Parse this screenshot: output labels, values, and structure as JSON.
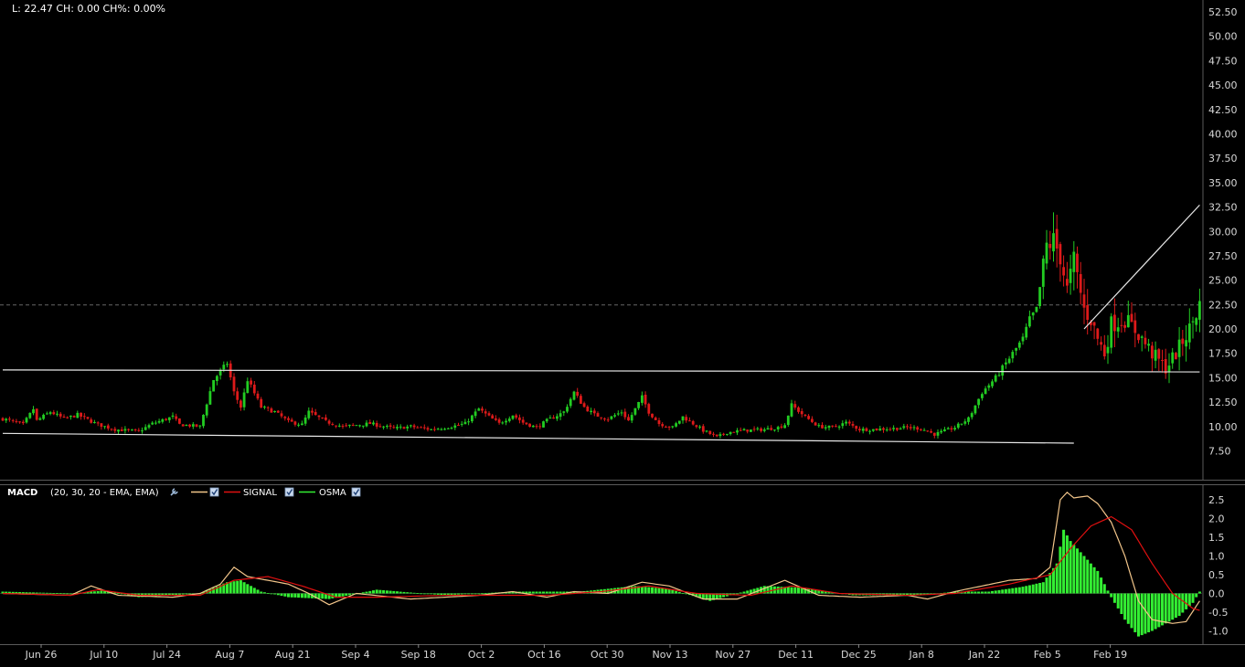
{
  "info_bar": {
    "text": "L: 22.47 CH: 0.00 CH%: 0.00%"
  },
  "colors": {
    "background": "#000000",
    "up": "#22cc22",
    "down": "#dd1a1a",
    "macd_line": "#f2c58a",
    "signal_line": "#e01010",
    "osma": "#33ee33",
    "trendline": "#e8e8e8"
  },
  "macd_legend": {
    "name": "MACD",
    "params": "(20, 30, 20 - EMA, EMA)",
    "signal": "SIGNAL",
    "osma": "OSMA",
    "settings_icon": "wrench-icon",
    "check_icon": "checkbox-checked-icon"
  },
  "chart_data": [
    {
      "type": "candlestick",
      "name_panel": "price",
      "title": "",
      "xlabel": "",
      "ylabel": "",
      "ylim": [
        5.0,
        53.5
      ],
      "yticks": [
        "52.50",
        "50.00",
        "47.50",
        "45.00",
        "42.50",
        "40.00",
        "37.50",
        "35.00",
        "32.50",
        "30.00",
        "27.50",
        "25.00",
        "22.50",
        "20.00",
        "17.50",
        "15.00",
        "12.50",
        "10.00",
        "7.50"
      ],
      "ytick_values": [
        52.5,
        50,
        47.5,
        45,
        42.5,
        40,
        37.5,
        35,
        32.5,
        30,
        27.5,
        25,
        22.5,
        20,
        17.5,
        15,
        12.5,
        10,
        7.5
      ],
      "xticks": [
        "Jun 26",
        "Jul 10",
        "Jul 24",
        "Aug 7",
        "Aug 21",
        "Sep 4",
        "Sep 18",
        "Oct 2",
        "Oct 16",
        "Oct 30",
        "Nov 13",
        "Nov 27",
        "Dec 11",
        "Dec 25",
        "Jan 8",
        "Jan 22",
        "Feb 5",
        "Feb 19"
      ],
      "last_value": 22.47,
      "price_path": [
        [
          0,
          10.8
        ],
        [
          6,
          10.2
        ],
        [
          9,
          11.8
        ],
        [
          10,
          10.6
        ],
        [
          14,
          11.5
        ],
        [
          18,
          10.8
        ],
        [
          22,
          11.2
        ],
        [
          28,
          10.2
        ],
        [
          33,
          9.7
        ],
        [
          40,
          9.5
        ],
        [
          44,
          10.3
        ],
        [
          50,
          11.0
        ],
        [
          52,
          10.2
        ],
        [
          58,
          10.0
        ],
        [
          62,
          14.8
        ],
        [
          66,
          16.5
        ],
        [
          68,
          13.5
        ],
        [
          70,
          12.0
        ],
        [
          72,
          14.8
        ],
        [
          76,
          12.0
        ],
        [
          80,
          11.5
        ],
        [
          84,
          10.5
        ],
        [
          88,
          10.2
        ],
        [
          90,
          11.5
        ],
        [
          95,
          10.5
        ],
        [
          100,
          10.0
        ],
        [
          108,
          10.3
        ],
        [
          115,
          9.8
        ],
        [
          120,
          10.0
        ],
        [
          126,
          9.7
        ],
        [
          132,
          10.0
        ],
        [
          136,
          10.3
        ],
        [
          140,
          11.8
        ],
        [
          143,
          11.0
        ],
        [
          146,
          10.3
        ],
        [
          150,
          11.2
        ],
        [
          153,
          10.4
        ],
        [
          157,
          9.9
        ],
        [
          160,
          10.6
        ],
        [
          165,
          11.5
        ],
        [
          168,
          13.5
        ],
        [
          171,
          12.0
        ],
        [
          174,
          11.2
        ],
        [
          178,
          10.8
        ],
        [
          182,
          11.5
        ],
        [
          184,
          10.6
        ],
        [
          188,
          13.0
        ],
        [
          190,
          11.5
        ],
        [
          193,
          10.3
        ],
        [
          197,
          9.9
        ],
        [
          200,
          11.0
        ],
        [
          203,
          10.3
        ],
        [
          206,
          9.6
        ],
        [
          210,
          8.9
        ],
        [
          213,
          9.4
        ],
        [
          218,
          9.6
        ],
        [
          224,
          9.7
        ],
        [
          228,
          9.9
        ],
        [
          230,
          10.2
        ],
        [
          232,
          12.2
        ],
        [
          236,
          11.0
        ],
        [
          240,
          10.0
        ],
        [
          244,
          9.9
        ],
        [
          248,
          10.4
        ],
        [
          252,
          9.7
        ],
        [
          256,
          9.7
        ],
        [
          262,
          9.8
        ],
        [
          266,
          9.9
        ],
        [
          270,
          9.8
        ],
        [
          274,
          9.2
        ],
        [
          280,
          9.9
        ],
        [
          284,
          10.8
        ],
        [
          288,
          13.5
        ],
        [
          292,
          15.0
        ],
        [
          296,
          17.0
        ],
        [
          300,
          19.0
        ],
        [
          302,
          21.0
        ],
        [
          304,
          22.0
        ],
        [
          307,
          28.5
        ],
        [
          309,
          29.0
        ],
        [
          311,
          27.5
        ],
        [
          313,
          24.0
        ],
        [
          315,
          27.0
        ],
        [
          318,
          22.0
        ],
        [
          320,
          21.0
        ],
        [
          322,
          19.0
        ],
        [
          324,
          17.5
        ],
        [
          326,
          20.5
        ],
        [
          330,
          21.0
        ],
        [
          334,
          19.5
        ],
        [
          338,
          17.5
        ],
        [
          342,
          16.0
        ],
        [
          345,
          17.5
        ],
        [
          349,
          20.0
        ],
        [
          352,
          22.47
        ]
      ]
    },
    {
      "type": "line",
      "name_panel": "macd",
      "title": "",
      "xlabel": "",
      "ylabel": "",
      "ylim": [
        -1.3,
        2.75
      ],
      "yticks": [
        "2.5",
        "2.0",
        "1.5",
        "1.0",
        "0.5",
        "0.0",
        "-0.5",
        "-1.0"
      ],
      "ytick_values": [
        2.5,
        2.0,
        1.5,
        1.0,
        0.5,
        0.0,
        -0.5,
        -1.0
      ],
      "series": [
        {
          "name": "MACD",
          "values": [
            [
              0,
              0.0
            ],
            [
              20,
              -0.05
            ],
            [
              26,
              0.2
            ],
            [
              34,
              -0.05
            ],
            [
              50,
              -0.1
            ],
            [
              58,
              0.0
            ],
            [
              64,
              0.25
            ],
            [
              68,
              0.7
            ],
            [
              72,
              0.45
            ],
            [
              78,
              0.35
            ],
            [
              84,
              0.25
            ],
            [
              90,
              0.0
            ],
            [
              96,
              -0.3
            ],
            [
              104,
              0.0
            ],
            [
              120,
              -0.15
            ],
            [
              140,
              -0.05
            ],
            [
              150,
              0.05
            ],
            [
              160,
              -0.1
            ],
            [
              168,
              0.05
            ],
            [
              178,
              0.0
            ],
            [
              188,
              0.3
            ],
            [
              196,
              0.2
            ],
            [
              206,
              -0.15
            ],
            [
              216,
              -0.15
            ],
            [
              230,
              0.35
            ],
            [
              240,
              -0.05
            ],
            [
              252,
              -0.1
            ],
            [
              266,
              -0.05
            ],
            [
              272,
              -0.15
            ],
            [
              280,
              0.05
            ],
            [
              288,
              0.2
            ],
            [
              296,
              0.35
            ],
            [
              304,
              0.4
            ],
            [
              308,
              0.7
            ],
            [
              311,
              2.5
            ],
            [
              313,
              2.7
            ],
            [
              315,
              2.55
            ],
            [
              319,
              2.6
            ],
            [
              322,
              2.4
            ],
            [
              326,
              1.9
            ],
            [
              330,
              1.0
            ],
            [
              334,
              -0.2
            ],
            [
              338,
              -0.7
            ],
            [
              344,
              -0.8
            ],
            [
              348,
              -0.75
            ],
            [
              352,
              -0.2
            ]
          ]
        },
        {
          "name": "SIGNAL",
          "values": [
            [
              0,
              0.0
            ],
            [
              20,
              -0.05
            ],
            [
              28,
              0.1
            ],
            [
              40,
              -0.05
            ],
            [
              58,
              -0.05
            ],
            [
              68,
              0.35
            ],
            [
              78,
              0.45
            ],
            [
              88,
              0.2
            ],
            [
              98,
              -0.1
            ],
            [
              110,
              -0.1
            ],
            [
              130,
              -0.05
            ],
            [
              160,
              -0.05
            ],
            [
              176,
              0.05
            ],
            [
              190,
              0.2
            ],
            [
              204,
              0.0
            ],
            [
              220,
              -0.05
            ],
            [
              232,
              0.2
            ],
            [
              246,
              0.0
            ],
            [
              266,
              -0.05
            ],
            [
              280,
              0.0
            ],
            [
              296,
              0.25
            ],
            [
              308,
              0.5
            ],
            [
              314,
              1.2
            ],
            [
              320,
              1.8
            ],
            [
              326,
              2.05
            ],
            [
              332,
              1.7
            ],
            [
              338,
              0.8
            ],
            [
              344,
              0.0
            ],
            [
              350,
              -0.4
            ],
            [
              352,
              -0.45
            ]
          ]
        }
      ],
      "osma": [
        [
          0,
          0.05
        ],
        [
          20,
          0.0
        ],
        [
          30,
          0.08
        ],
        [
          40,
          -0.1
        ],
        [
          58,
          0.0
        ],
        [
          66,
          0.3
        ],
        [
          70,
          0.35
        ],
        [
          76,
          0.05
        ],
        [
          84,
          -0.1
        ],
        [
          96,
          -0.15
        ],
        [
          110,
          0.1
        ],
        [
          130,
          -0.05
        ],
        [
          150,
          0.05
        ],
        [
          170,
          0.05
        ],
        [
          186,
          0.2
        ],
        [
          196,
          0.12
        ],
        [
          208,
          -0.2
        ],
        [
          224,
          0.2
        ],
        [
          236,
          0.15
        ],
        [
          250,
          -0.05
        ],
        [
          270,
          -0.05
        ],
        [
          280,
          0.05
        ],
        [
          290,
          0.05
        ],
        [
          300,
          0.18
        ],
        [
          306,
          0.3
        ],
        [
          310,
          0.8
        ],
        [
          312,
          1.7
        ],
        [
          314,
          1.4
        ],
        [
          318,
          1.0
        ],
        [
          322,
          0.6
        ],
        [
          326,
          -0.1
        ],
        [
          330,
          -0.7
        ],
        [
          334,
          -1.15
        ],
        [
          338,
          -1.0
        ],
        [
          342,
          -0.8
        ],
        [
          346,
          -0.6
        ],
        [
          350,
          -0.25
        ],
        [
          352,
          0.05
        ]
      ]
    }
  ],
  "trendlines": [
    {
      "name": "lower-support",
      "from": [
        0,
        9.3
      ],
      "to": [
        315,
        8.3
      ]
    },
    {
      "name": "horizontal-resistance",
      "from": [
        0,
        15.8
      ],
      "to": [
        352,
        15.6
      ]
    },
    {
      "name": "rising-trend",
      "from": [
        318,
        20.0
      ],
      "to": [
        352,
        32.7
      ]
    }
  ]
}
